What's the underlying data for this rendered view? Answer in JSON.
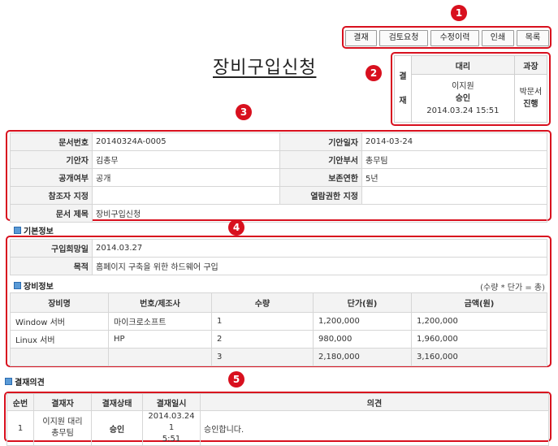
{
  "toolbar": {
    "buttons": [
      "결재",
      "검토요청",
      "수정이력",
      "인쇄",
      "목록"
    ]
  },
  "annotations": [
    "1",
    "2",
    "3",
    "4",
    "5"
  ],
  "document_title": "장비구입신청",
  "approval": {
    "side_label_1": "결",
    "side_label_2": "재",
    "columns": [
      {
        "header": "대리",
        "name": "이지원",
        "status": "승인",
        "date": "2014.03.24 15:51"
      },
      {
        "header": "과장",
        "name": "박문서",
        "status": "진행",
        "date": ""
      }
    ]
  },
  "doc_info": {
    "rows": [
      [
        {
          "label": "문서번호",
          "value": "20140324A-0005"
        },
        {
          "label": "기안일자",
          "value": "2014-03-24"
        }
      ],
      [
        {
          "label": "기안자",
          "value": "김총무"
        },
        {
          "label": "기안부서",
          "value": "총무팀"
        }
      ],
      [
        {
          "label": "공개여부",
          "value": "공개"
        },
        {
          "label": "보존연한",
          "value": "5년"
        }
      ],
      [
        {
          "label": "참조자 지정",
          "value": ""
        },
        {
          "label": "열람권한 지정",
          "value": ""
        }
      ]
    ],
    "subject_label": "문서 제목",
    "subject_value": "장비구입신청"
  },
  "basic_info": {
    "section_title": "기본정보",
    "rows": [
      {
        "label": "구입희망일",
        "value": "2014.03.27"
      },
      {
        "label": "목적",
        "value": "홈페이지 구축을 위한 하드웨어 구입"
      }
    ]
  },
  "equipment": {
    "section_title": "장비정보",
    "formula_note": "(수량 * 단가 = 총)",
    "headers": [
      "장비명",
      "번호/제조사",
      "수량",
      "단가(원)",
      "금액(원)"
    ],
    "rows": [
      [
        "Window 서버",
        "마이크로소프트",
        "1",
        "1,200,000",
        "1,200,000"
      ],
      [
        "Linux 서버",
        "HP",
        "2",
        "980,000",
        "1,960,000"
      ],
      [
        "",
        "",
        "3",
        "2,180,000",
        "3,160,000"
      ]
    ]
  },
  "opinions": {
    "section_title": "결재의견",
    "headers": [
      "순번",
      "결재자",
      "결재상태",
      "결재일시",
      "의견"
    ],
    "rows": [
      {
        "no": "1",
        "approver_line1": "이지원 대리",
        "approver_line2": "총무팀",
        "status": "승인",
        "date_line1": "2014.03.24 1",
        "date_line2": "5:51",
        "opinion": "승인합니다."
      }
    ]
  },
  "colors": {
    "highlight": "#d8101e",
    "label_bg": "#f3f3f3",
    "border": "#d6d6d6"
  }
}
